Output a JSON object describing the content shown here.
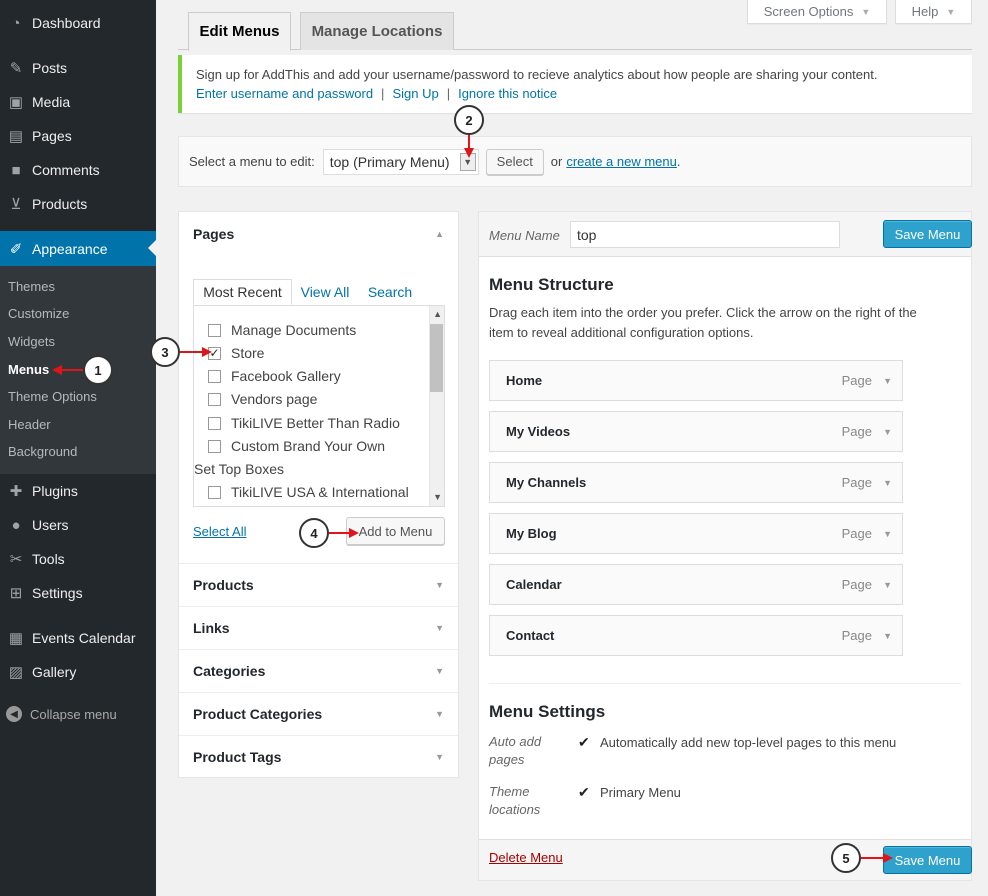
{
  "sidebar": {
    "items": [
      {
        "icon": "dashboard-icon",
        "glyph": "◔",
        "label": "Dashboard"
      },
      {
        "icon": "pin-icon",
        "glyph": "✎",
        "label": "Posts"
      },
      {
        "icon": "media-icon",
        "glyph": "▣",
        "label": "Media"
      },
      {
        "icon": "pages-icon",
        "glyph": "▤",
        "label": "Pages"
      },
      {
        "icon": "comments-icon",
        "glyph": "■",
        "label": "Comments"
      },
      {
        "icon": "cart-icon",
        "glyph": "⊻",
        "label": "Products"
      },
      {
        "icon": "brush-icon",
        "glyph": "✐",
        "label": "Appearance"
      },
      {
        "icon": "plugin-icon",
        "glyph": "✚",
        "label": "Plugins"
      },
      {
        "icon": "user-icon",
        "glyph": "●",
        "label": "Users"
      },
      {
        "icon": "wrench-icon",
        "glyph": "✂",
        "label": "Tools"
      },
      {
        "icon": "settings-icon",
        "glyph": "⊞",
        "label": "Settings"
      },
      {
        "icon": "calendar-icon",
        "glyph": "▦",
        "label": "Events Calendar"
      },
      {
        "icon": "gallery-icon",
        "glyph": "▨",
        "label": "Gallery"
      }
    ],
    "submenu": [
      "Themes",
      "Customize",
      "Widgets",
      "Menus",
      "Theme Options",
      "Header",
      "Background"
    ],
    "collapse_label": "Collapse menu"
  },
  "screen_options": {
    "screen_label": "Screen Options",
    "help_label": "Help"
  },
  "tabs": {
    "edit": "Edit Menus",
    "manage": "Manage Locations"
  },
  "notice": {
    "text": "Sign up for AddThis and add your username/password to recieve analytics about how people are sharing your content.",
    "link1": "Enter username and password",
    "link2": "Sign Up",
    "link3": "Ignore this notice",
    "sep": "|"
  },
  "select_bar": {
    "label": "Select a menu to edit:",
    "selected": "top (Primary Menu)",
    "select_button": "Select",
    "or_text": "or",
    "create_link": "create a new menu",
    "period": "."
  },
  "accordion": {
    "pages_title": "Pages",
    "inner_tabs": [
      "Most Recent",
      "View All",
      "Search"
    ],
    "pages": [
      {
        "label": "Manage Documents",
        "checked": false
      },
      {
        "label": "Store",
        "checked": true
      },
      {
        "label": "Facebook Gallery",
        "checked": false
      },
      {
        "label": "Vendors page",
        "checked": false
      },
      {
        "label": "TikiLIVE Better Than Radio",
        "checked": false
      },
      {
        "label": "Custom Brand Your Own",
        "checked": false
      },
      {
        "label": "Set Top Boxes",
        "checked": null
      },
      {
        "label": "TikiLIVE USA & International",
        "checked": false
      }
    ],
    "select_all": "Select All",
    "add_button": "Add to Menu",
    "sections": [
      "Products",
      "Links",
      "Categories",
      "Product Categories",
      "Product Tags"
    ]
  },
  "edit_panel": {
    "menu_name_label": "Menu Name",
    "menu_name_value": "top",
    "save_button": "Save Menu",
    "structure_title": "Menu Structure",
    "structure_desc_1": "Drag each item into the order you prefer. Click the arrow on the right of the",
    "structure_desc_2": "item to reveal additional configuration options.",
    "items": [
      {
        "label": "Home",
        "type": "Page"
      },
      {
        "label": "My Videos",
        "type": "Page"
      },
      {
        "label": "My Channels",
        "type": "Page"
      },
      {
        "label": "My Blog",
        "type": "Page"
      },
      {
        "label": "Calendar",
        "type": "Page"
      },
      {
        "label": "Contact",
        "type": "Page"
      }
    ],
    "settings_title": "Menu Settings",
    "auto_add_label_1": "Auto add",
    "auto_add_label_2": "pages",
    "auto_add_text": "Automatically add new top-level pages to this menu",
    "theme_loc_label_1": "Theme",
    "theme_loc_label_2": "locations",
    "theme_loc_text": "Primary Menu",
    "delete_link": "Delete Menu"
  },
  "callouts": [
    "1",
    "2",
    "3",
    "4",
    "5"
  ],
  "colors": {
    "accent": "#0073aa",
    "sidebar_bg": "#23282d",
    "primary_button": "#2ea2cc",
    "notice_border": "#7ad03a",
    "callout_arrow": "#e0151a",
    "delete_link": "#a00"
  }
}
